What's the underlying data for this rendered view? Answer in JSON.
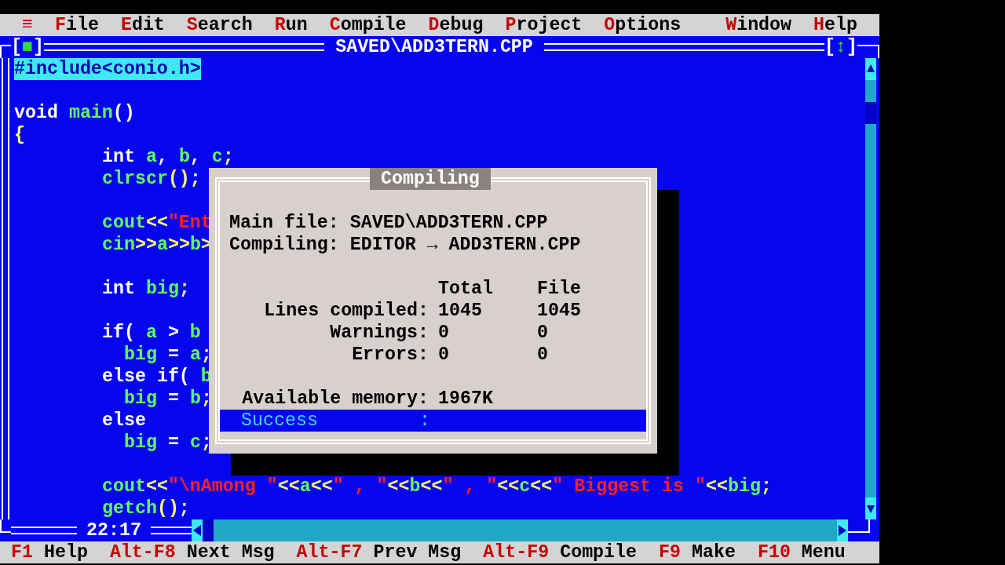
{
  "menu": [
    {
      "label": "≡"
    },
    {
      "label": "File"
    },
    {
      "label": "Edit"
    },
    {
      "label": "Search"
    },
    {
      "label": "Run"
    },
    {
      "label": "Compile"
    },
    {
      "label": "Debug"
    },
    {
      "label": "Project"
    },
    {
      "label": "Options"
    },
    {
      "label": "Window"
    },
    {
      "label": "Help"
    }
  ],
  "editor": {
    "title": "SAVED\\ADD3TERN.CPP",
    "close_box": "[■]",
    "zoom_box": "[↕]",
    "cursor_position": "22:17",
    "lines": [
      {
        "kind": "top",
        "selected": true,
        "tokens": [
          {
            "t": "#include<conio.h>",
            "kind": "kw"
          }
        ]
      },
      {
        "kind": "blank"
      },
      {
        "kind": "top",
        "selected": false,
        "tokens": [
          {
            "t": "void ",
            "kind": "kw"
          },
          {
            "t": "main",
            "kind": "id"
          },
          {
            "t": "()",
            "kind": "kw"
          }
        ]
      },
      {
        "kind": "top",
        "selected": false,
        "tokens": [
          {
            "t": "{",
            "kind": "sym"
          }
        ]
      },
      {
        "kind": "body",
        "selected": false,
        "tokens": [
          {
            "t": "int ",
            "kind": "kw"
          },
          {
            "t": "a",
            "kind": "id"
          },
          {
            "t": ", ",
            "kind": "kw"
          },
          {
            "t": "b",
            "kind": "id"
          },
          {
            "t": ", ",
            "kind": "kw"
          },
          {
            "t": "c",
            "kind": "id"
          },
          {
            "t": ";",
            "kind": "sym"
          }
        ]
      },
      {
        "kind": "body",
        "selected": false,
        "tokens": [
          {
            "t": "clrscr",
            "kind": "id"
          },
          {
            "t": "();",
            "kind": "sym"
          }
        ]
      },
      {
        "kind": "blank"
      },
      {
        "kind": "body",
        "selected": false,
        "tokens": [
          {
            "t": "cout",
            "kind": "id"
          },
          {
            "t": "<<",
            "kind": "sym"
          },
          {
            "t": "\"Ent",
            "kind": "str"
          }
        ]
      },
      {
        "kind": "body",
        "selected": false,
        "tokens": [
          {
            "t": "cin",
            "kind": "id"
          },
          {
            "t": ">>",
            "kind": "sym"
          },
          {
            "t": "a",
            "kind": "id"
          },
          {
            "t": ">>",
            "kind": "sym"
          },
          {
            "t": "b",
            "kind": "id"
          },
          {
            "t": ">",
            "kind": "sym"
          }
        ]
      },
      {
        "kind": "blank"
      },
      {
        "kind": "body",
        "selected": false,
        "tokens": [
          {
            "t": "int ",
            "kind": "kw"
          },
          {
            "t": "big",
            "kind": "id"
          },
          {
            "t": ";",
            "kind": "sym"
          }
        ]
      },
      {
        "kind": "blank"
      },
      {
        "kind": "body",
        "selected": false,
        "tokens": [
          {
            "t": "if( ",
            "kind": "kw"
          },
          {
            "t": "a",
            "kind": "id"
          },
          {
            "t": " > ",
            "kind": "kw"
          },
          {
            "t": "b",
            "kind": "id"
          }
        ]
      },
      {
        "kind": "nested",
        "selected": false,
        "tokens": [
          {
            "t": "big",
            "kind": "id"
          },
          {
            "t": " = ",
            "kind": "kw"
          },
          {
            "t": "a",
            "kind": "id"
          },
          {
            "t": ";",
            "kind": "sym"
          }
        ]
      },
      {
        "kind": "body",
        "selected": false,
        "tokens": [
          {
            "t": "else if( ",
            "kind": "kw"
          },
          {
            "t": "b",
            "kind": "id"
          }
        ]
      },
      {
        "kind": "nested",
        "selected": false,
        "tokens": [
          {
            "t": "big",
            "kind": "id"
          },
          {
            "t": " = ",
            "kind": "kw"
          },
          {
            "t": "b",
            "kind": "id"
          },
          {
            "t": ";",
            "kind": "sym"
          }
        ]
      },
      {
        "kind": "body",
        "selected": false,
        "tokens": [
          {
            "t": "else",
            "kind": "kw"
          }
        ]
      },
      {
        "kind": "nested",
        "selected": false,
        "tokens": [
          {
            "t": "big",
            "kind": "id"
          },
          {
            "t": " = ",
            "kind": "kw"
          },
          {
            "t": "c",
            "kind": "id"
          },
          {
            "t": ";",
            "kind": "sym"
          }
        ]
      },
      {
        "kind": "blank"
      },
      {
        "kind": "body",
        "selected": false,
        "tokens": [
          {
            "t": "cout",
            "kind": "id"
          },
          {
            "t": "<<",
            "kind": "sym"
          },
          {
            "t": "\"\\nAmong \"",
            "kind": "str"
          },
          {
            "t": "<<",
            "kind": "sym"
          },
          {
            "t": "a",
            "kind": "id"
          },
          {
            "t": "<<",
            "kind": "sym"
          },
          {
            "t": "\" , \"",
            "kind": "str"
          },
          {
            "t": "<<",
            "kind": "sym"
          },
          {
            "t": "b",
            "kind": "id"
          },
          {
            "t": "<<",
            "kind": "sym"
          },
          {
            "t": "\" , \"",
            "kind": "str"
          },
          {
            "t": "<<",
            "kind": "sym"
          },
          {
            "t": "c",
            "kind": "id"
          },
          {
            "t": "<<",
            "kind": "sym"
          },
          {
            "t": "\" Biggest is \"",
            "kind": "str"
          },
          {
            "t": "<<",
            "kind": "sym"
          },
          {
            "t": "big",
            "kind": "id"
          },
          {
            "t": ";",
            "kind": "sym"
          }
        ]
      },
      {
        "kind": "body",
        "selected": false,
        "tokens": [
          {
            "t": "getch",
            "kind": "id"
          },
          {
            "t": "();",
            "kind": "sym"
          }
        ]
      }
    ]
  },
  "dialog": {
    "title": "Compiling",
    "main_file_label": "Main file:",
    "main_file": "SAVED\\ADD3TERN.CPP",
    "compiling_label": "Compiling:",
    "compiling": "EDITOR → ADD3TERN.CPP",
    "columns": [
      "Total",
      "File"
    ],
    "rows": [
      {
        "label": "Lines compiled:",
        "values": [
          "1045",
          "1045"
        ]
      },
      {
        "label": "Warnings:",
        "values": [
          "0",
          "0"
        ]
      },
      {
        "label": "Errors:",
        "values": [
          "0",
          "0"
        ]
      }
    ],
    "memory_label": "Available memory:",
    "memory": "1967K",
    "result": "Success",
    "result_separator": ":"
  },
  "status_bar": [
    {
      "key": "F1",
      "label": "Help"
    },
    {
      "key": "Alt-F8",
      "label": "Next Msg"
    },
    {
      "key": "Alt-F7",
      "label": "Prev Msg"
    },
    {
      "key": "Alt-F9",
      "label": "Compile"
    },
    {
      "key": "F9",
      "label": "Make"
    },
    {
      "key": "F10",
      "label": "Menu"
    }
  ]
}
